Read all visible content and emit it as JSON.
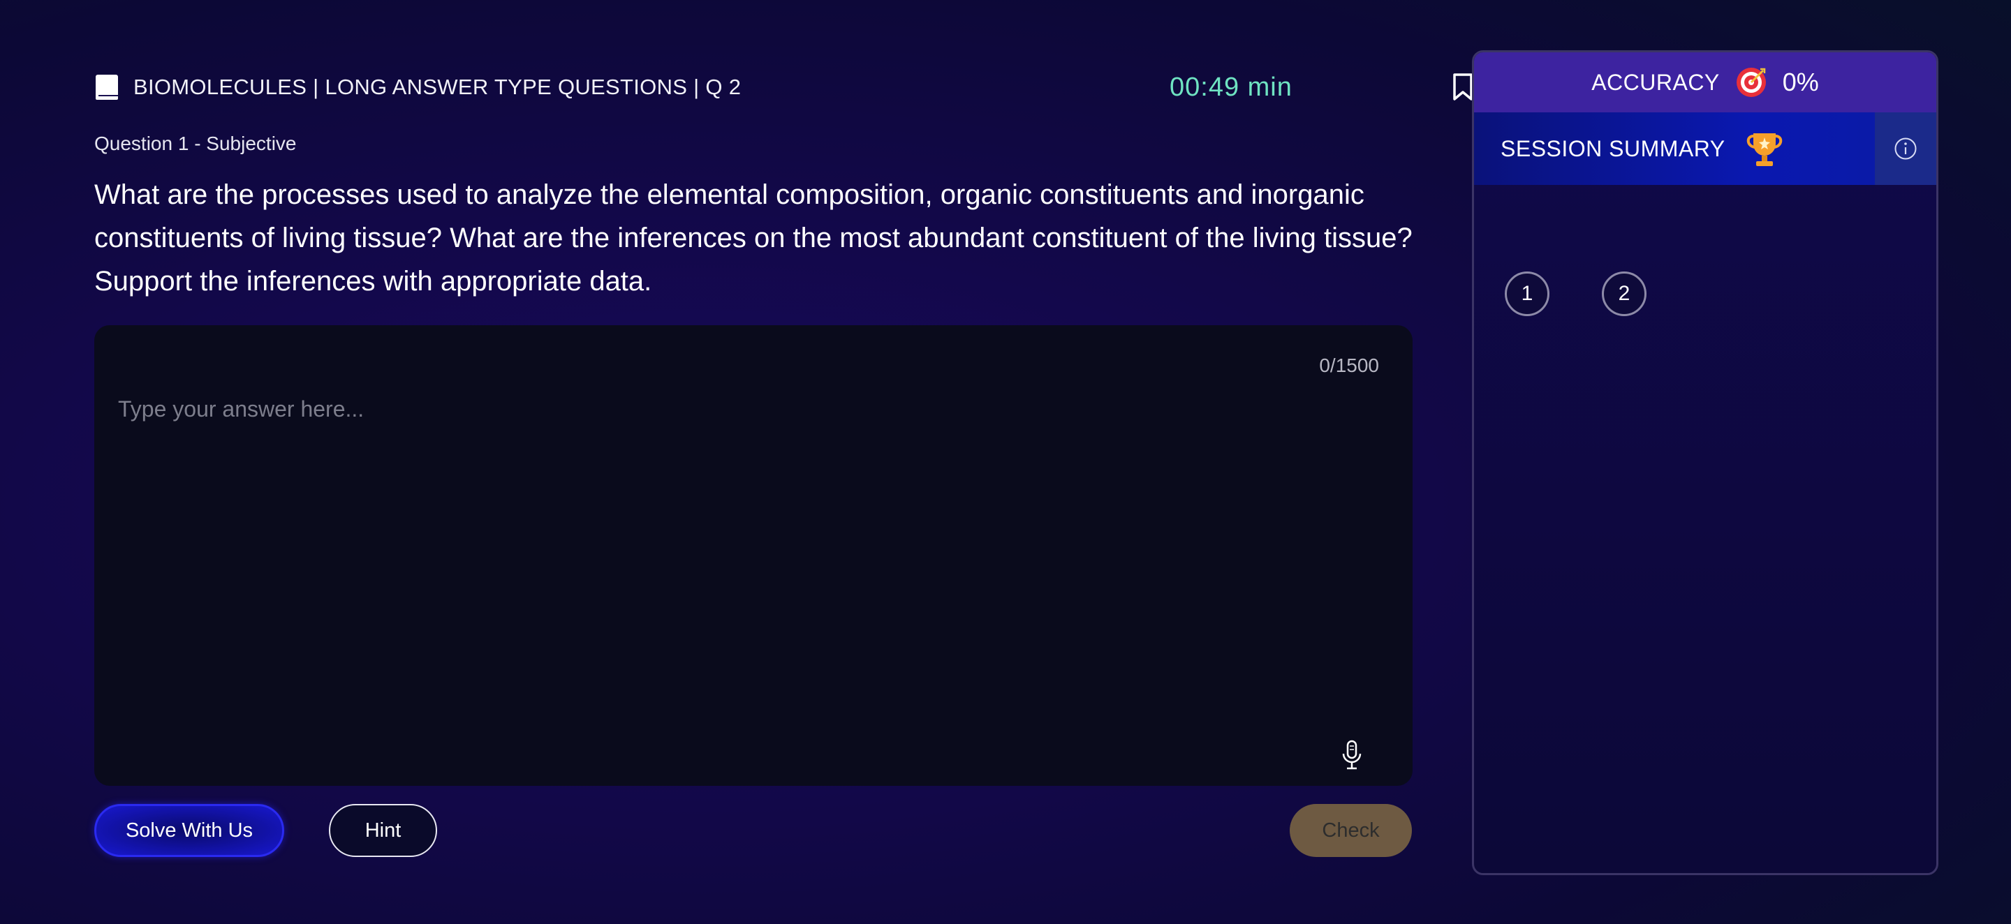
{
  "header": {
    "title": "BIOMOLECULES | LONG ANSWER TYPE QUESTIONS | Q 2",
    "timer": "00:49 min"
  },
  "question": {
    "label": "Question 1 - Subjective",
    "text": "What are the processes used to analyze the elemental composition, organic constituents and inorganic constituents of living tissue? What are the inferences on the most abundant constituent of the living tissue? Support the inferences with appropriate data."
  },
  "answer": {
    "counter": "0/1500",
    "placeholder": "Type your answer here...",
    "value": ""
  },
  "buttons": {
    "solve": "Solve With Us",
    "hint": "Hint",
    "check": "Check"
  },
  "panel": {
    "accuracy_label": "ACCURACY",
    "accuracy_value": "0%",
    "summary_label": "SESSION SUMMARY",
    "questions": [
      "1",
      "2"
    ]
  },
  "icons": {
    "book": "book-icon",
    "bookmark": "bookmark-icon",
    "close": "close-icon",
    "mic": "microphone-icon",
    "target": "target-icon",
    "trophy": "trophy-icon",
    "info": "info-icon"
  },
  "colors": {
    "timer": "#6fe3c2",
    "accuracy_bar": "#3d23a0",
    "summary_bar": "#0a18b0",
    "check_button": "#6e5a42",
    "solve_button": "#1818d0"
  }
}
